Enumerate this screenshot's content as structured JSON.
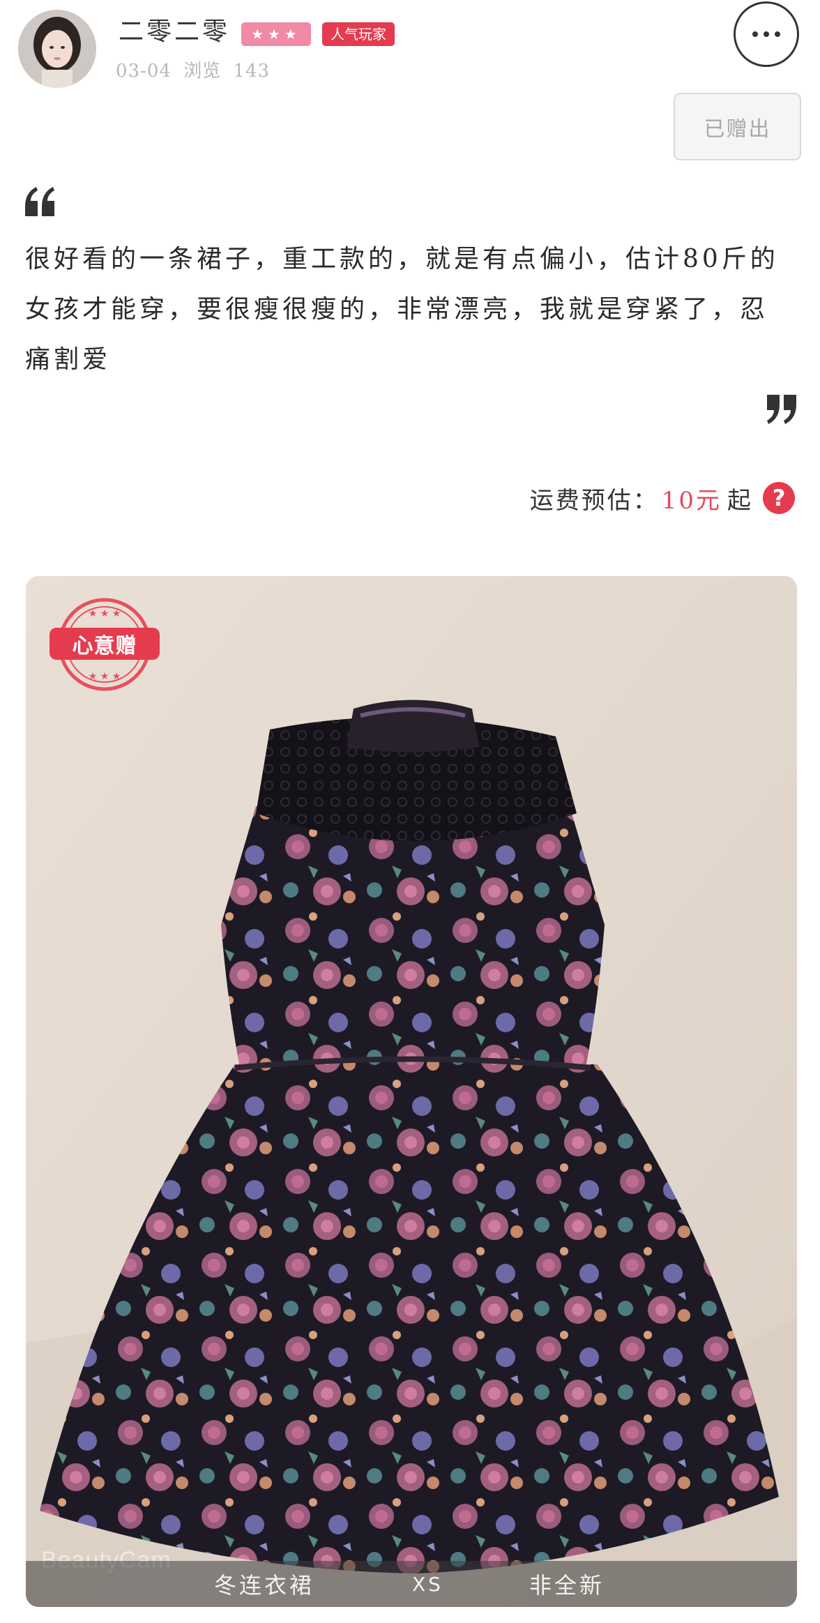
{
  "post": {
    "username": "二零二零",
    "level_stars": "★★★",
    "badge": "人气玩家",
    "date": "03-04",
    "views_label": "浏览",
    "views_count": "143",
    "status_button": "已赠出"
  },
  "description": {
    "quote_open_icon": "quote-open-icon",
    "text": "很好看的一条裙子，重工款的，就是有点偏小，估计80斤的女孩才能穿，要很瘦很瘦的，非常漂亮，我就是穿紧了，忍痛割爱",
    "quote_close_icon": "quote-close-icon"
  },
  "shipping": {
    "label": "运费预估：",
    "price": "10元",
    "suffix": "起",
    "help_icon": "?"
  },
  "photo": {
    "stamp_label": "心意赠",
    "watermark": "BeautyCam",
    "tags": [
      "冬连衣裙",
      "XS",
      "非全新"
    ]
  },
  "colors": {
    "accent_red": "#e53b4f",
    "star_pink": "#f08aa6",
    "price_red": "#e44a5c"
  }
}
